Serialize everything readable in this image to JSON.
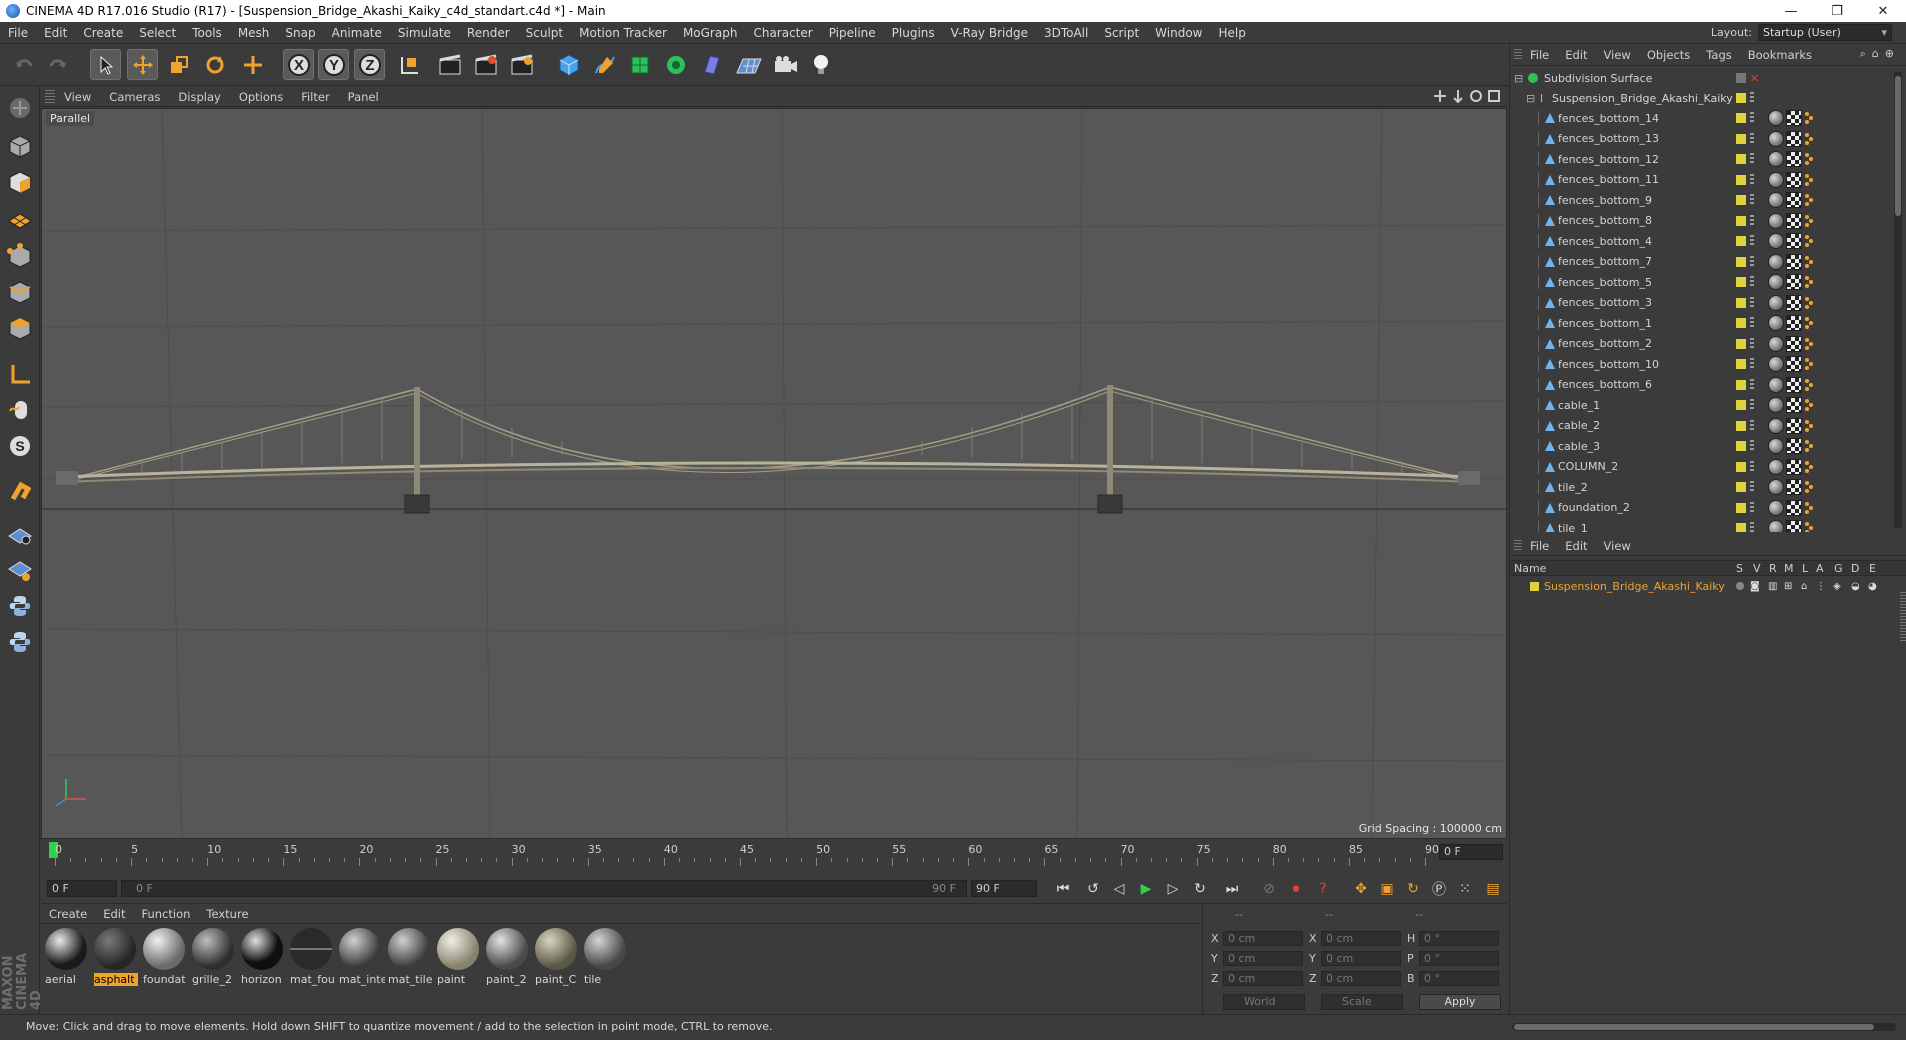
{
  "window": {
    "title": "CINEMA 4D R17.016 Studio (R17) - [Suspension_Bridge_Akashi_Kaiky_c4d_standart.c4d *] - Main",
    "minimize": "—",
    "restore": "❐",
    "close": "✕"
  },
  "menu": [
    "File",
    "Edit",
    "Create",
    "Select",
    "Tools",
    "Mesh",
    "Snap",
    "Animate",
    "Simulate",
    "Render",
    "Sculpt",
    "Motion Tracker",
    "MoGraph",
    "Character",
    "Pipeline",
    "Plugins",
    "V-Ray Bridge",
    "3DToAll",
    "Script",
    "Window",
    "Help"
  ],
  "layout": {
    "label": "Layout:",
    "value": "Startup (User)"
  },
  "viewport": {
    "menu": [
      "View",
      "Cameras",
      "Display",
      "Options",
      "Filter",
      "Panel"
    ],
    "camera_label": "Parallel",
    "grid_spacing": "Grid Spacing : 100000 cm"
  },
  "timeline": {
    "ticks": [
      "0",
      "5",
      "10",
      "15",
      "20",
      "25",
      "30",
      "35",
      "40",
      "45",
      "50",
      "55",
      "60",
      "65",
      "70",
      "75",
      "80",
      "85",
      "90"
    ],
    "current_frame": "0 F",
    "start_field": "0 F",
    "range_start": "0 F",
    "range_end": "90 F",
    "end_field": "90 F"
  },
  "materials": {
    "menu": [
      "Create",
      "Edit",
      "Function",
      "Texture"
    ],
    "items": [
      {
        "label": "aerial"
      },
      {
        "label": "asphalt"
      },
      {
        "label": "foundat"
      },
      {
        "label": "grille_2"
      },
      {
        "label": "horizon"
      },
      {
        "label": "mat_fou"
      },
      {
        "label": "mat_inte"
      },
      {
        "label": "mat_tile"
      },
      {
        "label": "paint"
      },
      {
        "label": "paint_2"
      },
      {
        "label": "paint_C"
      },
      {
        "label": "tile"
      }
    ]
  },
  "coords": {
    "headers": [
      "--",
      "--",
      "--"
    ],
    "rows": [
      {
        "a": "X",
        "av": "0 cm",
        "b": "X",
        "bv": "0 cm",
        "c": "H",
        "cv": "0 °"
      },
      {
        "a": "Y",
        "av": "0 cm",
        "b": "Y",
        "bv": "0 cm",
        "c": "P",
        "cv": "0 °"
      },
      {
        "a": "Z",
        "av": "0 cm",
        "b": "Z",
        "bv": "0 cm",
        "c": "B",
        "cv": "0 °"
      }
    ],
    "world": "World",
    "scale": "Scale",
    "apply": "Apply"
  },
  "objects": {
    "menu": [
      "File",
      "Edit",
      "View",
      "Objects",
      "Tags",
      "Bookmarks"
    ],
    "root": "Subdivision Surface",
    "group": "Suspension_Bridge_Akashi_Kaiky",
    "items": [
      "fences_bottom_14",
      "fences_bottom_13",
      "fences_bottom_12",
      "fences_bottom_11",
      "fences_bottom_9",
      "fences_bottom_8",
      "fences_bottom_4",
      "fences_bottom_7",
      "fences_bottom_5",
      "fences_bottom_3",
      "fences_bottom_1",
      "fences_bottom_2",
      "fences_bottom_10",
      "fences_bottom_6",
      "cable_1",
      "cable_2",
      "cable_3",
      "COLUMN_2",
      "tile_2",
      "foundation_2",
      "tile_1"
    ]
  },
  "layers": {
    "menu": [
      "File",
      "Edit",
      "View"
    ],
    "columns": [
      "Name",
      "S",
      "V",
      "R",
      "M",
      "L",
      "A",
      "G",
      "D",
      "E"
    ],
    "item": "Suspension_Bridge_Akashi_Kaiky"
  },
  "status": "Move: Click and drag to move elements. Hold down SHIFT to quantize movement / add to the selection in point mode, CTRL to remove.",
  "colors": {
    "selection": "#f0a32c",
    "layer_color": "#e0d23a",
    "play_green": "#2fd04a"
  }
}
